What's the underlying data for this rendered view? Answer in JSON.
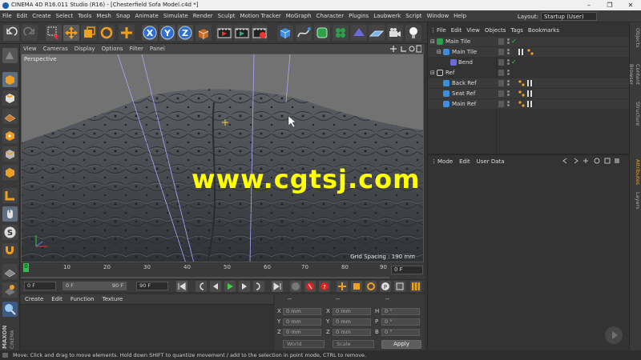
{
  "window": {
    "title": "CINEMA 4D R16.011 Studio (R16) - [Chesterfield Sofa Model.c4d *]",
    "minimize": "–",
    "maximize": "❐",
    "close": "✕"
  },
  "menubar": {
    "items": [
      "File",
      "Edit",
      "Create",
      "Select",
      "Tools",
      "Mesh",
      "Snap",
      "Animate",
      "Simulate",
      "Render",
      "Sculpt",
      "Motion Tracker",
      "MoGraph",
      "Character",
      "Plugins",
      "Laubwerk",
      "Script",
      "Window",
      "Help"
    ],
    "layout_label": "Layout:",
    "layout_value": "Startup (User)"
  },
  "toolbar": {
    "axis_x": "X",
    "axis_y": "Y",
    "axis_z": "Z"
  },
  "viewport": {
    "menu": [
      "View",
      "Cameras",
      "Display",
      "Options",
      "Filter",
      "Panel"
    ],
    "name": "Perspective",
    "grid_spacing": "Grid Spacing : 190 mm",
    "watermark": "www.cgtsj.com"
  },
  "timeline": {
    "ticks": [
      "0",
      "10",
      "20",
      "30",
      "40",
      "50",
      "60",
      "70",
      "80",
      "90"
    ],
    "current_frame_marker": "0",
    "end_frame_field": "0 F",
    "start_field": "0 F",
    "range_start": "0 F",
    "range_end": "90 F",
    "max_field": "90 F"
  },
  "materials": {
    "menu": [
      "Create",
      "Edit",
      "Function",
      "Texture"
    ]
  },
  "coordinates": {
    "header_a": "--",
    "header_b": "--",
    "header_c": "--",
    "rows": [
      {
        "l1": "X",
        "v1": "0 mm",
        "l2": "X",
        "v2": "0 mm",
        "l3": "H",
        "v3": "0 °"
      },
      {
        "l1": "Y",
        "v1": "0 mm",
        "l2": "Y",
        "v2": "0 mm",
        "l3": "P",
        "v3": "0 °"
      },
      {
        "l1": "Z",
        "v1": "0 mm",
        "l2": "Z",
        "v2": "0 mm",
        "l3": "B",
        "v3": "0 °"
      }
    ],
    "mode_world": "World",
    "mode_scale": "Scale",
    "apply": "Apply"
  },
  "object_manager": {
    "menu": [
      "File",
      "Edit",
      "View",
      "Objects",
      "Tags",
      "Bookmarks"
    ],
    "objects": [
      {
        "name": "Main Tile",
        "indent": 0
      },
      {
        "name": "Main Tile",
        "indent": 1
      },
      {
        "name": "Bend",
        "indent": 2
      },
      {
        "name": "Ref",
        "indent": 0
      },
      {
        "name": "Back Ref",
        "indent": 1
      },
      {
        "name": "Seat Ref",
        "indent": 1
      },
      {
        "name": "Main Ref",
        "indent": 1
      }
    ]
  },
  "attribute_manager": {
    "menu": [
      "Mode",
      "Edit",
      "User Data"
    ]
  },
  "right_tabs": [
    "Objects",
    "Content Browser",
    "Structure",
    "Attributes",
    "Layers"
  ],
  "logo": "MAXON CINEMA 4D",
  "status": "Move: Click and drag to move elements. Hold down SHIFT to quantize movement / add to the selection in point mode, CTRL to remove.",
  "colors": {
    "accent_orange": "#f0a020",
    "axis_blue": "#2e6fd1",
    "check_green": "#3cd23c",
    "watermark_yellow": "#ffff00"
  }
}
